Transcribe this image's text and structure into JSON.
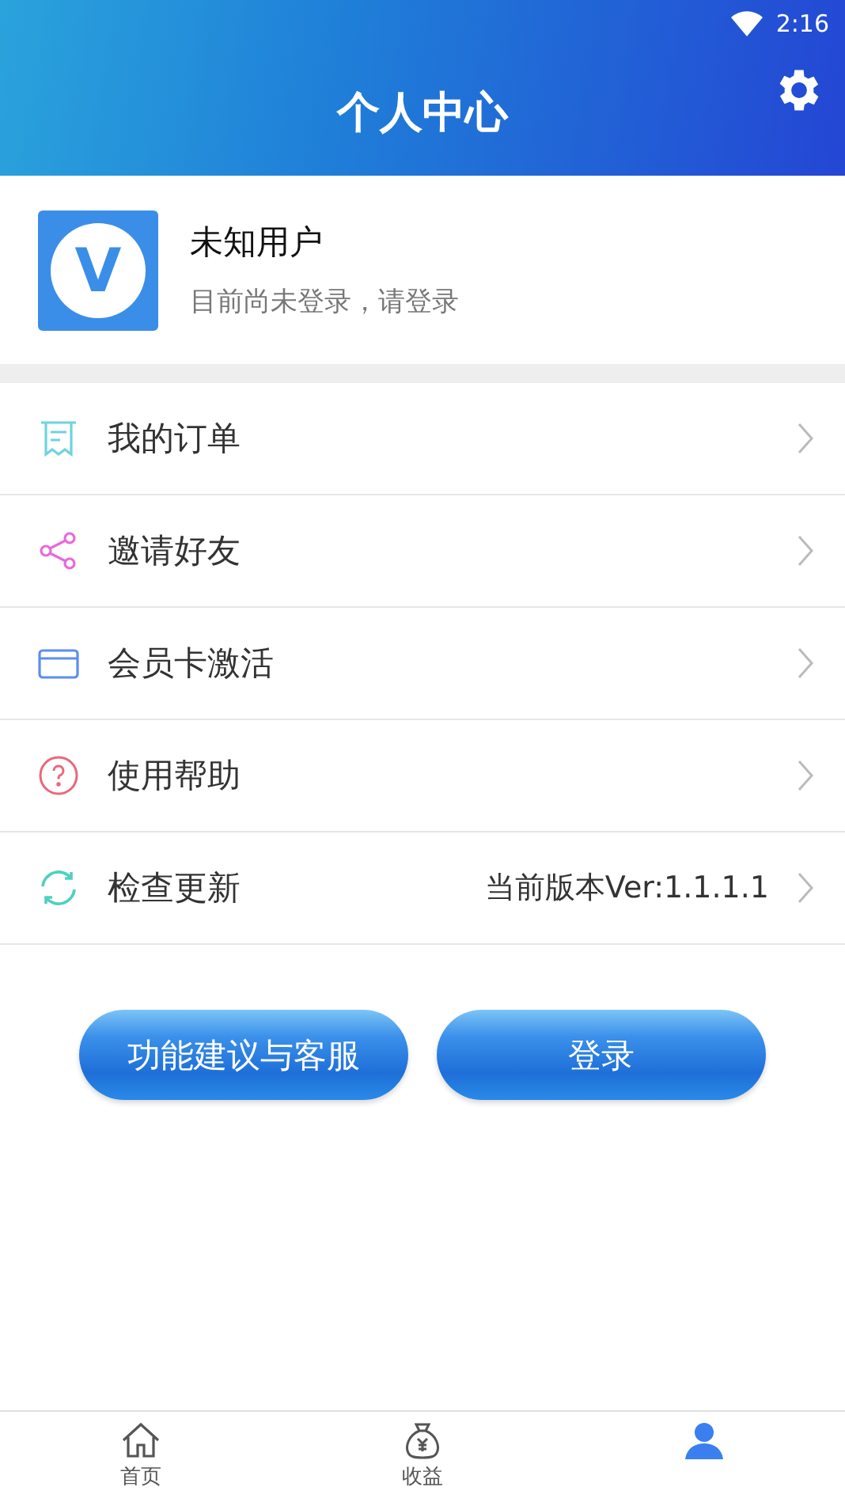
{
  "status_bar": {
    "time": "2:16"
  },
  "header": {
    "title": "个人中心"
  },
  "profile": {
    "logo_letter": "V",
    "name": "未知用户",
    "subtitle": "目前尚未登录，请登录"
  },
  "menu": [
    {
      "kind": "receipt",
      "label": "我的订单"
    },
    {
      "kind": "share",
      "label": "邀请好友"
    },
    {
      "kind": "card",
      "label": "会员卡激活"
    },
    {
      "kind": "help",
      "label": "使用帮助"
    },
    {
      "kind": "refresh",
      "label": "检查更新",
      "value": "当前版本Ver:1.1.1.1"
    }
  ],
  "buttons": [
    "功能建议与客服",
    "登录"
  ],
  "tabs": [
    {
      "kind": "home",
      "label": "首页",
      "selected": false
    },
    {
      "kind": "money",
      "label": "收益",
      "selected": false
    },
    {
      "kind": "person",
      "selected": true
    }
  ]
}
